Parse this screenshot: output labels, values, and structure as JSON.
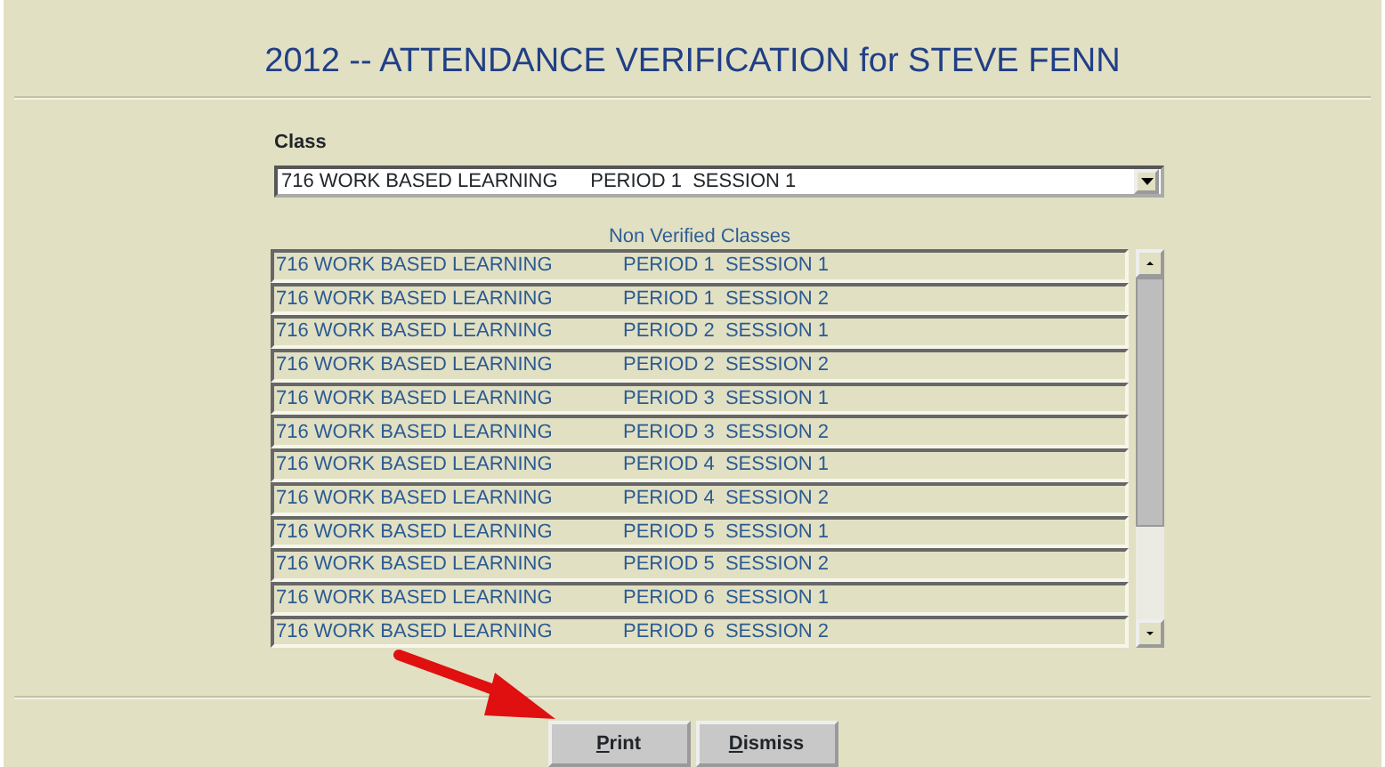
{
  "title": "2012 -- ATTENDANCE VERIFICATION for STEVE FENN",
  "class_field": {
    "label": "Class",
    "value": "716 WORK BASED LEARNING      PERIOD 1  SESSION 1"
  },
  "list": {
    "heading": "Non Verified Classes",
    "rows": [
      {
        "course": "716 WORK BASED LEARNING",
        "period": "PERIOD 1  SESSION 1"
      },
      {
        "course": "716 WORK BASED LEARNING",
        "period": "PERIOD 1  SESSION 2"
      },
      {
        "course": "716 WORK BASED LEARNING",
        "period": "PERIOD 2  SESSION 1"
      },
      {
        "course": "716 WORK BASED LEARNING",
        "period": "PERIOD 2  SESSION 2"
      },
      {
        "course": "716 WORK BASED LEARNING",
        "period": "PERIOD 3  SESSION 1"
      },
      {
        "course": "716 WORK BASED LEARNING",
        "period": "PERIOD 3  SESSION 2"
      },
      {
        "course": "716 WORK BASED LEARNING",
        "period": "PERIOD 4  SESSION 1"
      },
      {
        "course": "716 WORK BASED LEARNING",
        "period": "PERIOD 4  SESSION 2"
      },
      {
        "course": "716 WORK BASED LEARNING",
        "period": "PERIOD 5  SESSION 1"
      },
      {
        "course": "716 WORK BASED LEARNING",
        "period": "PERIOD 5  SESSION 2"
      },
      {
        "course": "716 WORK BASED LEARNING",
        "period": "PERIOD 6  SESSION 1"
      },
      {
        "course": "716 WORK BASED LEARNING",
        "period": "PERIOD 6  SESSION 2"
      }
    ]
  },
  "buttons": [
    "Print",
    "Dismiss"
  ]
}
